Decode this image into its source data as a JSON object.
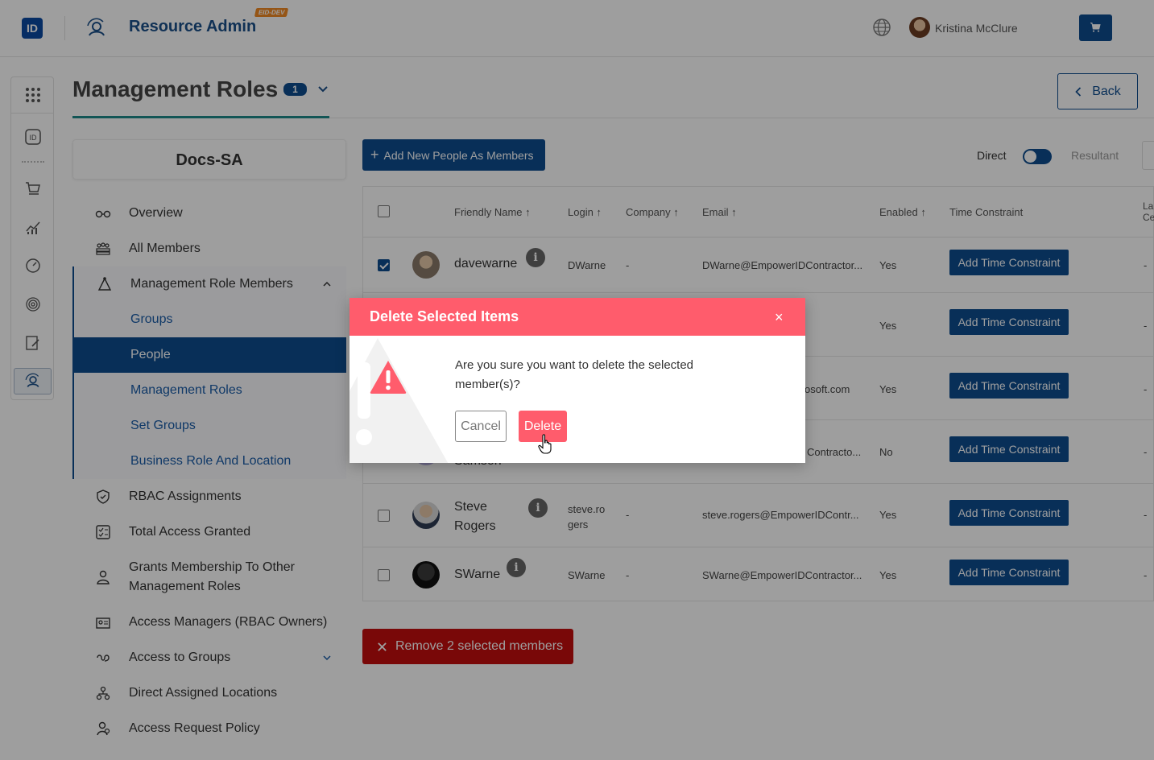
{
  "header": {
    "logo_text": "ID",
    "app_title": "Resource Admin",
    "env_badge": "EID-DEV",
    "user_name": "Kristina McClure"
  },
  "page": {
    "title": "Management Roles",
    "badge_count": "1",
    "back_label": "Back"
  },
  "sidebar": {
    "entity_name": "Docs-SA",
    "items": [
      {
        "label": "Overview",
        "icon": "glasses-icon"
      },
      {
        "label": "All Members",
        "icon": "group-icon"
      },
      {
        "label": "Management Role Members",
        "icon": "triangle-nodes-icon"
      },
      {
        "label": "RBAC Assignments",
        "icon": "shield-icon"
      },
      {
        "label": "Total Access Granted",
        "icon": "checklist-icon"
      },
      {
        "label": "Grants Membership To Other Management Roles",
        "icon": "user-tie-icon"
      },
      {
        "label": "Access Managers (RBAC Owners)",
        "icon": "id-badge-icon"
      },
      {
        "label": "Access to Groups",
        "icon": "link-icon"
      },
      {
        "label": "Direct Assigned Locations",
        "icon": "hierarchy-icon"
      },
      {
        "label": "Access Request Policy",
        "icon": "policy-user-icon"
      }
    ],
    "sub_items": [
      "Groups",
      "People",
      "Management Roles",
      "Set Groups",
      "Business Role And Location"
    ]
  },
  "toolbar": {
    "add_button": "Add New People As Members",
    "direct_label": "Direct",
    "resultant_label": "Resultant"
  },
  "table": {
    "columns": [
      "Friendly Name",
      "Login",
      "Company",
      "Email",
      "Enabled",
      "Time Constraint",
      "La Ce"
    ],
    "rows": [
      {
        "name": "davewarne",
        "login": "DWarne",
        "company": "-",
        "email": "DWarne@EmpowerIDContractor...",
        "enabled": "Yes",
        "action": "Add Time Constraint",
        "last": "-",
        "checked": true
      },
      {
        "name": "",
        "login": "",
        "company": "",
        "email": "",
        "enabled": "Yes",
        "action": "Add Time Constraint",
        "last": "-",
        "checked": false
      },
      {
        "name": "",
        "login": "",
        "company": "",
        "email": "osoft.com",
        "enabled": "Yes",
        "action": "Add Time Constraint",
        "last": "-",
        "checked": false
      },
      {
        "name": "Samson",
        "login": "",
        "company": "",
        "email": "Contracto...",
        "enabled": "No",
        "action": "Add Time Constraint",
        "last": "-",
        "checked": false
      },
      {
        "name": "Steve Rogers",
        "login": "steve.ro gers",
        "company": "-",
        "email": "steve.rogers@EmpowerIDContr...",
        "enabled": "Yes",
        "action": "Add Time Constraint",
        "last": "-",
        "checked": false
      },
      {
        "name": "SWarne",
        "login": "SWarne",
        "company": "-",
        "email": "SWarne@EmpowerIDContractor...",
        "enabled": "Yes",
        "action": "Add Time Constraint",
        "last": "-",
        "checked": false
      }
    ]
  },
  "remove_button": "Remove 2 selected members",
  "modal": {
    "title": "Delete Selected Items",
    "close": "×",
    "message": "Are you sure you want to delete the selected member(s)?",
    "cancel": "Cancel",
    "delete": "Delete"
  },
  "colors": {
    "primary": "#0e4c8f",
    "danger": "#c30e0e",
    "modal_header": "#ff5c6c",
    "accent_underline": "#1d8a8a"
  }
}
